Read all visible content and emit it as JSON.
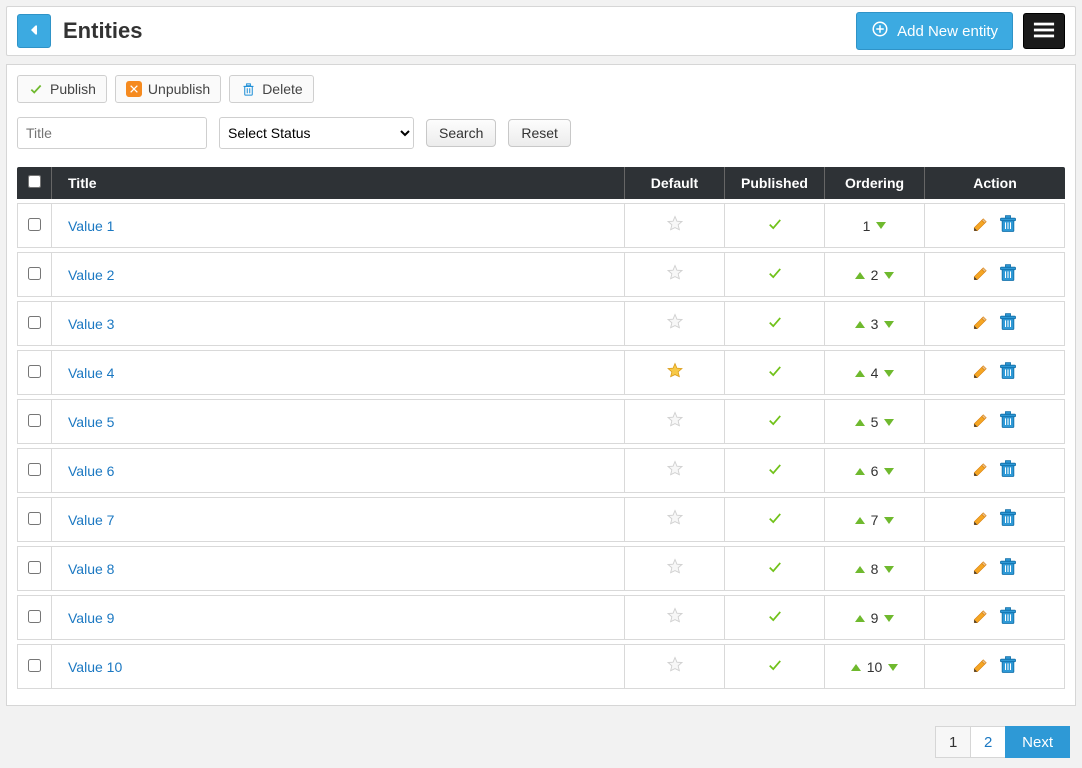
{
  "header": {
    "title": "Entities",
    "add_label": "Add New entity"
  },
  "toolbar": {
    "publish": "Publish",
    "unpublish": "Unpublish",
    "delete": "Delete"
  },
  "filters": {
    "title_placeholder": "Title",
    "status_label": "Select Status",
    "search": "Search",
    "reset": "Reset"
  },
  "columns": {
    "title": "Title",
    "default": "Default",
    "published": "Published",
    "ordering": "Ordering",
    "action": "Action"
  },
  "rows": [
    {
      "title": "Value 1",
      "default": false,
      "published": true,
      "order": 1,
      "showUp": false,
      "showDown": true
    },
    {
      "title": "Value 2",
      "default": false,
      "published": true,
      "order": 2,
      "showUp": true,
      "showDown": true
    },
    {
      "title": "Value 3",
      "default": false,
      "published": true,
      "order": 3,
      "showUp": true,
      "showDown": true
    },
    {
      "title": "Value 4",
      "default": true,
      "published": true,
      "order": 4,
      "showUp": true,
      "showDown": true
    },
    {
      "title": "Value 5",
      "default": false,
      "published": true,
      "order": 5,
      "showUp": true,
      "showDown": true
    },
    {
      "title": "Value 6",
      "default": false,
      "published": true,
      "order": 6,
      "showUp": true,
      "showDown": true
    },
    {
      "title": "Value 7",
      "default": false,
      "published": true,
      "order": 7,
      "showUp": true,
      "showDown": true
    },
    {
      "title": "Value 8",
      "default": false,
      "published": true,
      "order": 8,
      "showUp": true,
      "showDown": true
    },
    {
      "title": "Value 9",
      "default": false,
      "published": true,
      "order": 9,
      "showUp": true,
      "showDown": true
    },
    {
      "title": "Value 10",
      "default": false,
      "published": true,
      "order": 10,
      "showUp": true,
      "showDown": true
    }
  ],
  "pagination": {
    "pages": [
      "1",
      "2"
    ],
    "current": "1",
    "next": "Next"
  }
}
